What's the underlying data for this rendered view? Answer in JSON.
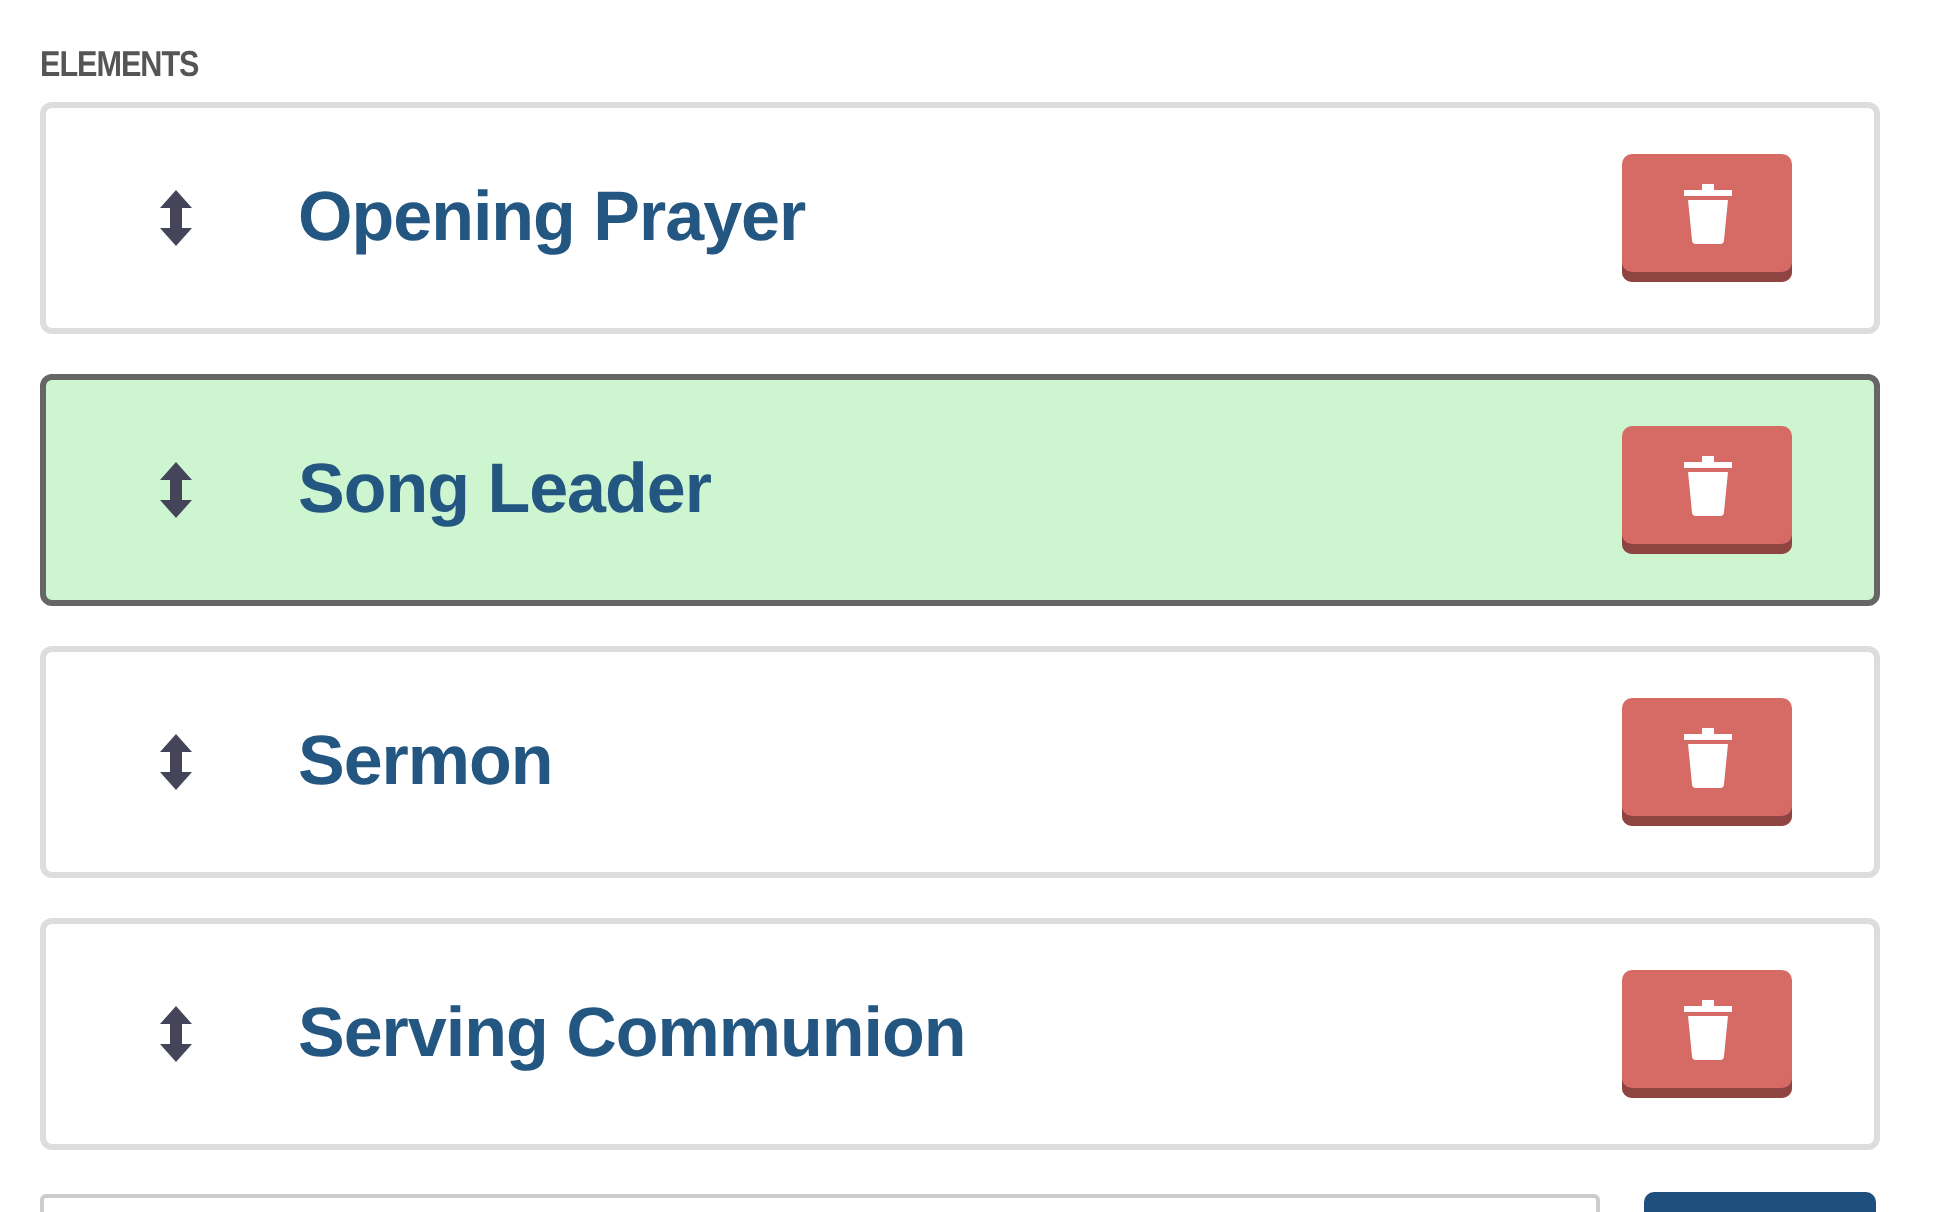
{
  "heading": "ELEMENTS",
  "elements": [
    {
      "name": "Opening Prayer",
      "selected": false
    },
    {
      "name": "Song Leader",
      "selected": true
    },
    {
      "name": "Sermon",
      "selected": false
    },
    {
      "name": "Serving Communion",
      "selected": false
    }
  ]
}
